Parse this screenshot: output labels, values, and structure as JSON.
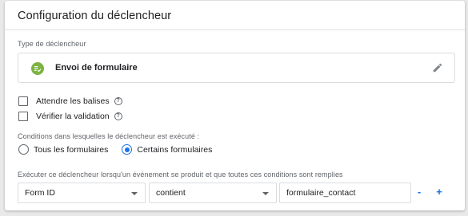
{
  "card": {
    "title": "Configuration du déclencheur"
  },
  "trigger_type": {
    "section_label": "Type de déclencheur",
    "name": "Envoi de formulaire",
    "icon": "form-submit-icon",
    "icon_color": "#7cb342"
  },
  "options": {
    "wait_for_tags": "Attendre les balises",
    "check_validation": "Vérifier la validation"
  },
  "conditions": {
    "section_label": "Conditions dans lesquelles le déclencheur est exécuté :",
    "all_forms": "Tous les formulaires",
    "some_forms": "Certains formulaires",
    "selected": "some_forms"
  },
  "filter": {
    "section_label": "Exécuter ce déclencheur lorsqu'un événement se produit et que toutes ces conditions sont remplies",
    "variable": "Form ID",
    "operator": "contient",
    "value": "formulaire_contact",
    "remove_label": "-",
    "add_label": "+"
  },
  "colors": {
    "accent": "#1a73e8"
  }
}
